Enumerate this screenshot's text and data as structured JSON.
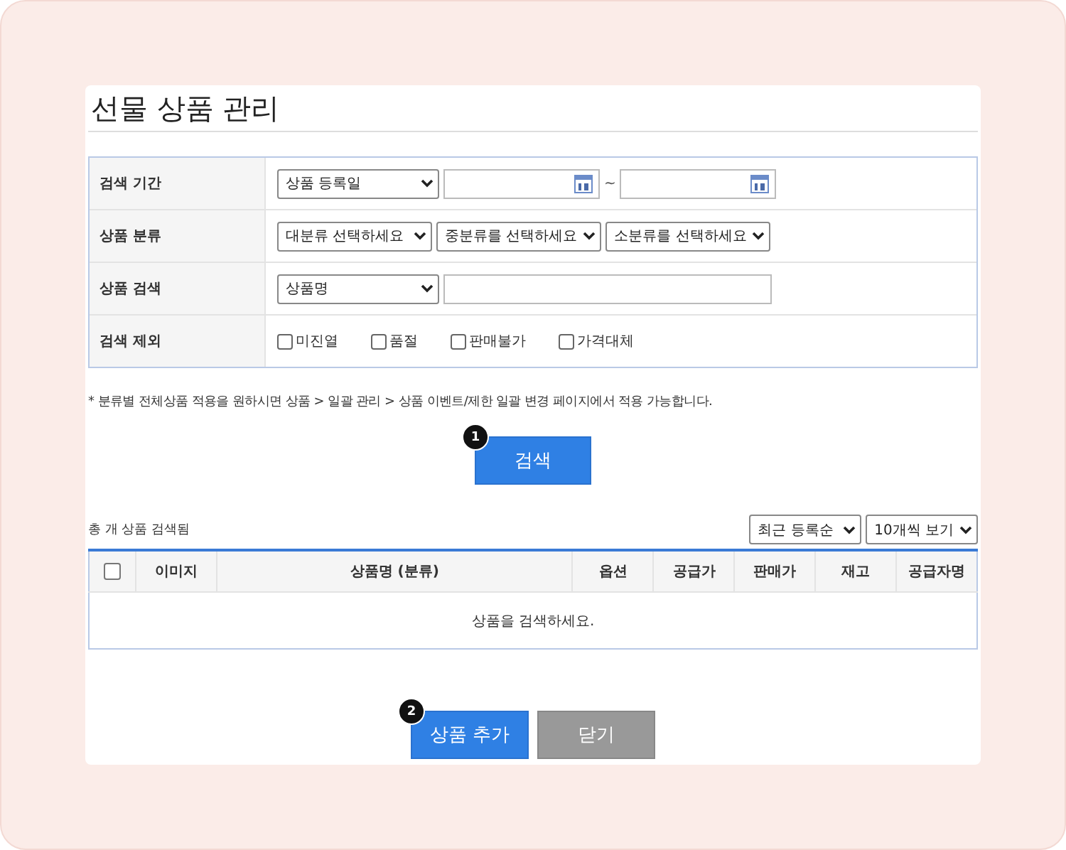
{
  "title": "선물 상품 관리",
  "filters": [
    {
      "label": "검색 기간",
      "kind": "date-range",
      "select": "상품 등록일",
      "separator": "~"
    },
    {
      "label": "상품 분류",
      "kind": "selects",
      "selects": [
        "대분류 선택하세요",
        "중분류를 선택하세요",
        "소분류를 선택하세요"
      ]
    },
    {
      "label": "상품 검색",
      "kind": "select-input",
      "select": "상품명"
    },
    {
      "label": "검색 제외",
      "kind": "checkboxes",
      "options": [
        {
          "label": "미진열",
          "checked": false
        },
        {
          "label": "품절",
          "checked": false
        },
        {
          "label": "판매불가",
          "checked": false
        },
        {
          "label": "가격대체",
          "checked": false
        }
      ]
    }
  ],
  "note": "* 분류별 전체상품 적용을 원하시면 상품 > 일괄 관리 > 상품 이벤트/제한 일괄 변경 페이지에서 적용 가능합니다.",
  "search_button": {
    "label": "검색",
    "badge": "1"
  },
  "result_count": "총 개 상품 검색됨",
  "sort_select": "최근 등록순",
  "page_size_select": "10개씩 보기",
  "table": {
    "select_all_checked": false,
    "columns": [
      "이미지",
      "상품명 (분류)",
      "옵션",
      "공급가",
      "판매가",
      "재고",
      "공급자명"
    ],
    "empty_message": "상품을 검색하세요."
  },
  "buttons": [
    {
      "label": "상품 추가",
      "kind": "primary",
      "badge": "2"
    },
    {
      "label": "닫기",
      "kind": "secondary"
    }
  ]
}
